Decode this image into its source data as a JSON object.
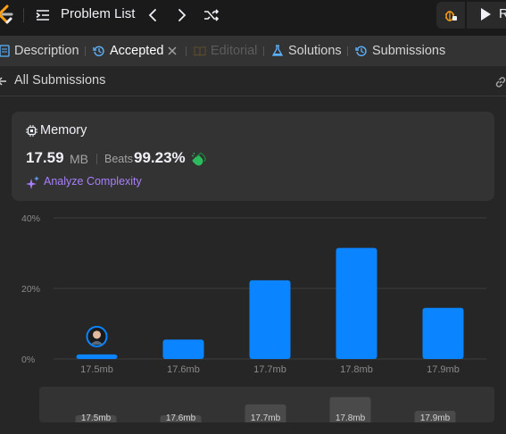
{
  "topbar": {
    "problem_list_label": "Problem List",
    "run_label_partial": "R"
  },
  "tabs": {
    "description": "Description",
    "accepted": "Accepted",
    "editorial": "Editorial",
    "solutions": "Solutions",
    "submissions": "Submissions"
  },
  "subheader": {
    "label": "All Submissions"
  },
  "memory": {
    "title": "Memory",
    "value": "17.59",
    "unit": "MB",
    "beats_label": "Beats",
    "beats_value": "99.23%",
    "analyze_label": "Analyze Complexity"
  },
  "colors": {
    "bar": "#0a84ff",
    "accent_purple": "#a87ffb",
    "background": "#1a1a1a",
    "panel": "#262626"
  },
  "chart_data": {
    "type": "bar",
    "categories": [
      "17.5mb",
      "17.6mb",
      "17.7mb",
      "17.8mb",
      "17.9mb"
    ],
    "values": [
      1.3,
      5.5,
      22.3,
      31.5,
      14.5
    ],
    "y_ticks": [
      "40%",
      "20%",
      "0%"
    ],
    "ylim": [
      0,
      40
    ],
    "grid": true,
    "highlight_category": "17.5mb"
  },
  "slider": {
    "labels": [
      "17.5mb",
      "17.6mb",
      "17.7mb",
      "17.8mb",
      "17.9mb"
    ],
    "values": [
      1.3,
      5.5,
      22.3,
      31.5,
      14.5
    ]
  }
}
